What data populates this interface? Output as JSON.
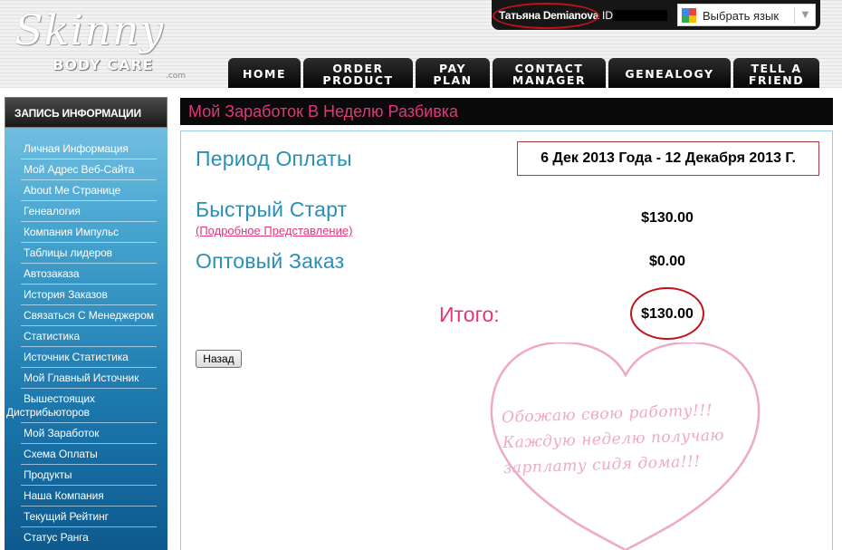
{
  "header": {
    "logo": {
      "script": "Skinny",
      "brand": "BODY CARE",
      "suffix": ".com"
    },
    "user": {
      "name": "Татьяна Demianova",
      "id_label": "ID"
    },
    "language": {
      "label": "Выбрать язык",
      "arrow": "▼"
    },
    "nav": [
      {
        "label": "HOME"
      },
      {
        "label": "ORDER\nPRODUCT"
      },
      {
        "label": "PAY\nPLAN"
      },
      {
        "label": "CONTACT\nMANAGER"
      },
      {
        "label": "GENEALOGY"
      },
      {
        "label": "TELL A\nFRIEND"
      }
    ]
  },
  "sidebar": {
    "title": "ЗАПИСЬ ИНФОРМАЦИИ",
    "items": [
      {
        "label": "Личная Информация"
      },
      {
        "label": "Мой Адрес Веб-Сайта"
      },
      {
        "label": "About Me Странице"
      },
      {
        "label": "Генеалогия"
      },
      {
        "label": "Компания Импульс"
      },
      {
        "label": "Таблицы лидеров"
      },
      {
        "label": "Автозаказа"
      },
      {
        "label": "История Заказов"
      },
      {
        "label": "Связаться С Менеджером"
      },
      {
        "label": "Статистика"
      },
      {
        "label": "Источник Статистика"
      },
      {
        "label": "Мой Главный Источник"
      },
      {
        "label": "Вышестоящих",
        "label2": "Дистрибьюторов"
      },
      {
        "label": "Мой Заработок"
      },
      {
        "label": "Схема Оплаты"
      },
      {
        "label": "Продукты"
      },
      {
        "label": "Наша Компания"
      },
      {
        "label": "Текущий Рейтинг"
      },
      {
        "label": "Статус Ранга"
      }
    ]
  },
  "main": {
    "title": "Мой Заработок В Неделю Разбивка",
    "period": {
      "label": "Период Оплаты",
      "value": "6 Дек 2013 Года - 12 Декабря 2013 Г."
    },
    "fast_start": {
      "label": "Быстрый Старт",
      "link": "(Подробное Представление)",
      "amount": "$130.00"
    },
    "wholesale": {
      "label": "Оптовый Заказ",
      "amount": "$0.00"
    },
    "total": {
      "label": "Итого:",
      "amount": "$130.00"
    },
    "back_button": "Назад"
  },
  "overlay": {
    "lines": [
      "Обожаю свою работу!!!",
      "Каждую неделю получаю",
      "зарплату сидя дома!!!"
    ],
    "heart_color": "#f0a8c6",
    "highlight_color": "#c1121c"
  }
}
